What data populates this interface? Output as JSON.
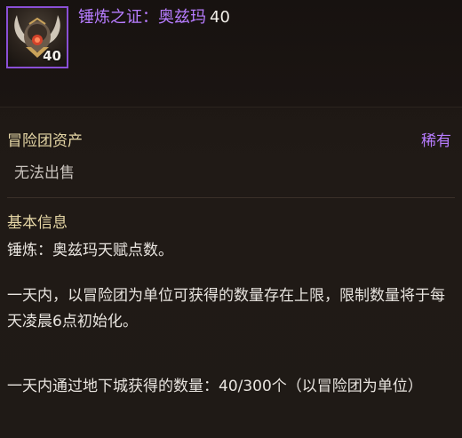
{
  "item": {
    "name": "锤炼之证：奥兹玛",
    "level": "40",
    "count": "40",
    "icon": "ozma-emblem-icon"
  },
  "type_row": {
    "label": "冒险团资产",
    "rarity": "稀有",
    "sell_note": "无法出售"
  },
  "info": {
    "heading": "基本信息",
    "line1": "锤炼：奥兹玛天赋点数。",
    "para1": "一天内，以冒险团为单位可获得的数量存在上限，限制数量将于每天凌晨6点初始化。",
    "para2": "一天内通过地下城获得的数量：40/300个（以冒险团为单位）"
  },
  "colors": {
    "rarity_purple": "#b77cff",
    "heading_gold": "#e6d7a6",
    "frame_purple": "#8a4fd6"
  }
}
